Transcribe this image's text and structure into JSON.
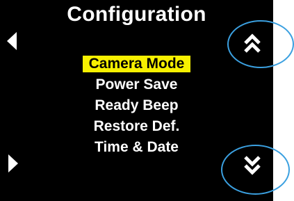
{
  "screen": {
    "title": "Configuration",
    "menu": {
      "items": [
        {
          "label": "Camera Mode",
          "selected": true
        },
        {
          "label": "Power Save",
          "selected": false
        },
        {
          "label": "Ready Beep",
          "selected": false
        },
        {
          "label": "Restore Def.",
          "selected": false
        },
        {
          "label": "Time & Date",
          "selected": false
        }
      ]
    },
    "icons": {
      "nav_left": "chevron-left-icon",
      "nav_right": "chevron-right-icon",
      "scroll_up": "double-chevron-up-icon",
      "scroll_down": "double-chevron-down-icon"
    }
  },
  "colors": {
    "background": "#000000",
    "text": "#ffffff",
    "highlight": "#f7f000",
    "callout": "#3ba0e0"
  }
}
